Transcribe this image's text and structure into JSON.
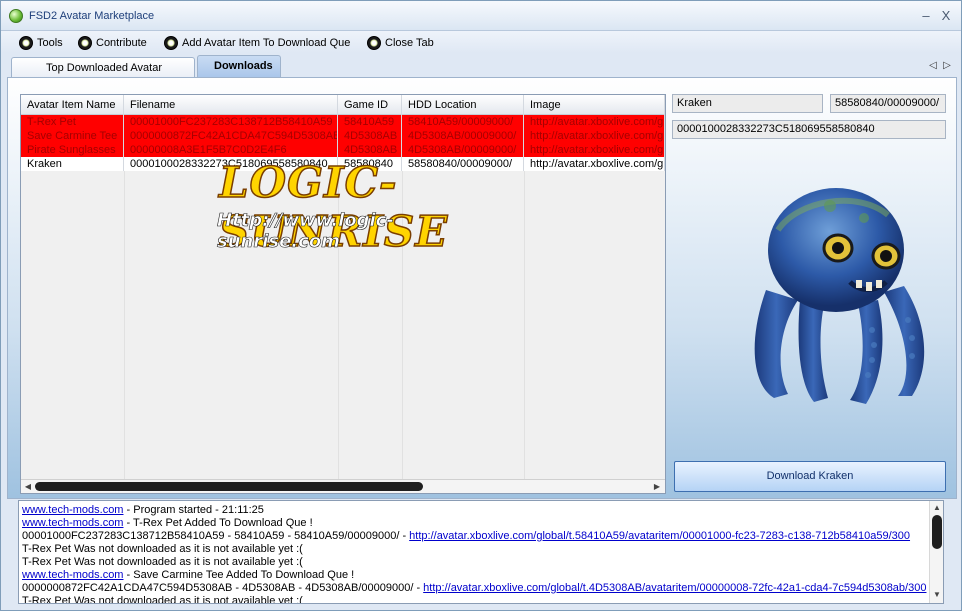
{
  "window": {
    "title": "FSD2 Avatar Marketplace",
    "minimize": "–",
    "close": "X"
  },
  "menu": [
    "Tools",
    "Contribute",
    "Add Avatar Item To Download Que",
    "Close Tab"
  ],
  "tabs": [
    {
      "label": "Top Downloaded Avatar Items",
      "active": false
    },
    {
      "label": "Downloads",
      "active": true
    }
  ],
  "tab_nav": {
    "prev": "◁",
    "next": "▷"
  },
  "grid": {
    "columns": [
      "Avatar Item Name",
      "Filename",
      "Game ID",
      "HDD Location",
      "Image"
    ],
    "rows": [
      {
        "name": "T-Rex Pet",
        "filename": "00001000FC237283C138712B58410A59",
        "gameid": "58410A59",
        "location": "58410A59/00009000/",
        "image": "http://avatar.xboxlive.com/global/t.58410A59",
        "status": "error"
      },
      {
        "name": "Save Carmine Tee",
        "filename": "0000000872FC42A1CDA47C594D5308AB",
        "gameid": "4D5308AB",
        "location": "4D5308AB/00009000/",
        "image": "http://avatar.xboxlive.com/global/t.4D5308AB",
        "status": "error"
      },
      {
        "name": "Pirate Sunglasses",
        "filename": "00000008A3E1F5B7C0D2E4F6",
        "gameid": "4D5308AB",
        "location": "4D5308AB/00009000/",
        "image": "http://avatar.xboxlive.com/global/t.4D5308AB",
        "status": "error"
      },
      {
        "name": "Kraken",
        "filename": "0000100028332273C518069558580840",
        "gameid": "58580840",
        "location": "58580840/00009000/",
        "image": "http://avatar.xboxlive.com/g",
        "status": "ok"
      }
    ],
    "scroll_left": "◀",
    "scroll_right": "▶"
  },
  "watermark": {
    "main": "LOGIC-SUNRISE",
    "url": "Http://www.logic-sunrise.com"
  },
  "details": {
    "name": "Kraken",
    "location": "58580840/00009000/",
    "filename": "0000100028332273C518069558580840"
  },
  "download_button": "Download  Kraken",
  "log": [
    {
      "link": "www.tech-mods.com",
      "text": " - Program started - 21:11:25"
    },
    {
      "link": "www.tech-mods.com",
      "text": " -  T-Rex Pet Added To Download Que !"
    },
    {
      "text": "00001000FC237283C138712B58410A59 - 58410A59 - 58410A59/00009000/ - ",
      "link2": "http://avatar.xboxlive.com/global/t.58410A59/avataritem/00001000-fc23-7283-c138-712b58410a59/300"
    },
    {
      "text": " T-Rex Pet Was not downloaded as it is not available yet :("
    },
    {
      "text": " T-Rex Pet Was not downloaded as it is not available yet :("
    },
    {
      "link": "www.tech-mods.com",
      "text": " -  Save Carmine Tee Added To Download Que !"
    },
    {
      "text": "0000000872FC42A1CDA47C594D5308AB - 4D5308AB - 4D5308AB/00009000/ - ",
      "link2": "http://avatar.xboxlive.com/global/t.4D5308AB/avataritem/00000008-72fc-42a1-cda4-7c594d5308ab/300"
    },
    {
      "text": " T-Rex Pet Was not downloaded as it is not available yet :("
    }
  ],
  "log_scroll": {
    "up": "▲",
    "down": "▼"
  }
}
